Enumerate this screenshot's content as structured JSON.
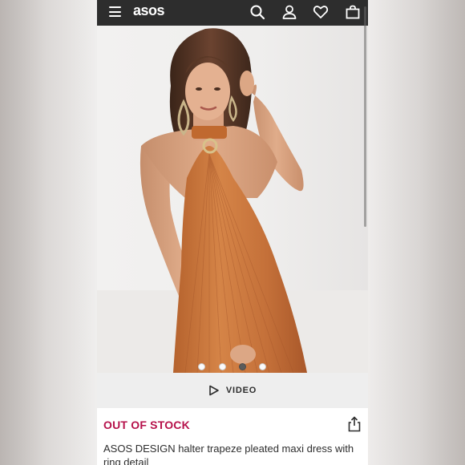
{
  "header": {
    "logo": "asos",
    "icons": [
      "menu-icon",
      "search-icon",
      "account-icon",
      "wishlist-heart-icon",
      "bag-icon"
    ]
  },
  "gallery": {
    "slide_count": 4,
    "active_slide": 3
  },
  "video": {
    "label": "VIDEO",
    "icon": "play-icon"
  },
  "product": {
    "stock_status": "OUT OF STOCK",
    "name": "ASOS DESIGN halter trapeze pleated maxi dress with ring detail"
  },
  "colors": {
    "header_bg": "#2d2d2d",
    "stock_red": "#b6124b",
    "dress": "#c8753b"
  }
}
